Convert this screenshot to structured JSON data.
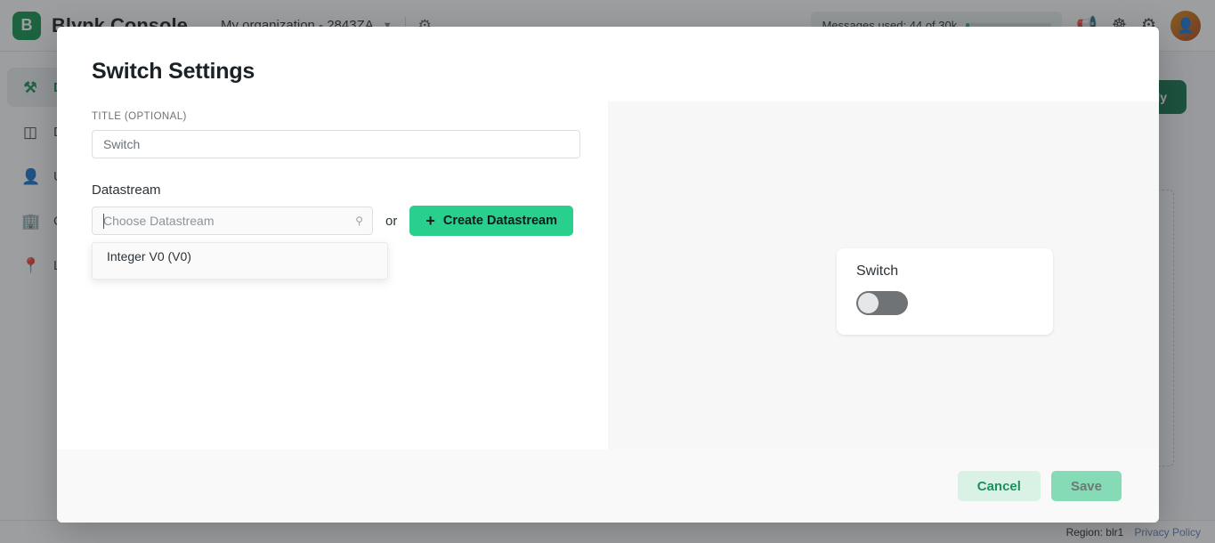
{
  "background": {
    "topbar": {
      "brand_initial": "B",
      "brand_name": "Blynk Console",
      "org_name": "My organization - 2843ZA",
      "org_chevron": "chevron-down-icon",
      "gear_icon": "gear-icon",
      "messages_used": "Messages used: 44 of 30k",
      "announce_icon": "megaphone-icon",
      "help_icon": "lifebuoy-icon",
      "settings_icon": "settings-icon",
      "avatar_icon": "user-avatar"
    },
    "sidebar": {
      "items": [
        {
          "label": "Developer Zone",
          "icon": "tools-icon",
          "active": true
        },
        {
          "label": "Devices",
          "icon": "cube-icon",
          "active": false
        },
        {
          "label": "Users",
          "icon": "user-icon",
          "active": false
        },
        {
          "label": "Organizations",
          "icon": "building-icon",
          "active": false
        },
        {
          "label": "Locations",
          "icon": "location-pin-icon",
          "active": false
        }
      ]
    },
    "main": {
      "primary_button": "Save And Apply",
      "folder_icon": "folder-icon"
    },
    "footer": {
      "region": "Region: blr1",
      "privacy_link": "Privacy Policy"
    }
  },
  "modal": {
    "title": "Switch Settings",
    "title_field": {
      "label": "TITLE (OPTIONAL)",
      "value": "Switch",
      "placeholder": "Switch"
    },
    "datastream": {
      "section_label": "Datastream",
      "search_placeholder": "Choose Datastream",
      "search_value": "",
      "search_icon": "search-icon",
      "or_text": "or",
      "create_button": "Create Datastream",
      "plus_icon": "plus-icon",
      "options": [
        "Integer V0 (V0)"
      ]
    },
    "preview": {
      "widget_title": "Switch",
      "toggle_state": "off"
    },
    "footer": {
      "cancel_label": "Cancel",
      "save_label": "Save"
    }
  },
  "colors": {
    "brand_green": "#17924f",
    "accent_green": "#29cf8d",
    "cancel_bg": "#d9f2e5",
    "save_bg": "#84dbb5",
    "toggle_track": "#6f7376",
    "toggle_knob": "#e6e7e8"
  }
}
